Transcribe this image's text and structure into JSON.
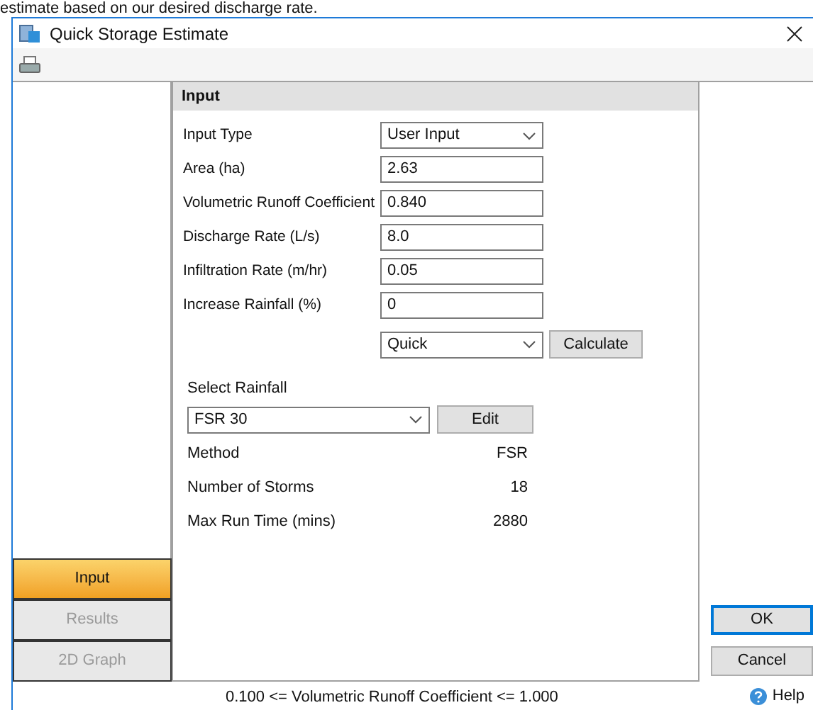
{
  "caption": "estimate based on our desired discharge rate.",
  "window": {
    "title": "Quick Storage Estimate"
  },
  "panel": {
    "title": "Input"
  },
  "fields": [
    {
      "kind": "dropdown",
      "label": "Input Type",
      "value": "User Input"
    },
    {
      "kind": "text",
      "label": "Area (ha)",
      "value": "2.63"
    },
    {
      "kind": "text",
      "label": "Volumetric Runoff Coefficient",
      "value": "0.840"
    },
    {
      "kind": "text",
      "label": "Discharge Rate (L/s)",
      "value": "8.0"
    },
    {
      "kind": "text",
      "label": "Infiltration Rate (m/hr)",
      "value": "0.05"
    },
    {
      "kind": "text",
      "label": "Increase Rainfall (%)",
      "value": "0"
    }
  ],
  "mode": {
    "value": "Quick",
    "button": "Calculate"
  },
  "rainfall": {
    "label": "Select Rainfall",
    "value": "FSR 30",
    "button": "Edit",
    "info": [
      {
        "label": "Method",
        "value": "FSR"
      },
      {
        "label": "Number of Storms",
        "value": "18"
      },
      {
        "label": "Max Run Time (mins)",
        "value": "2880"
      }
    ]
  },
  "nav": [
    {
      "label": "Input",
      "selected": true,
      "disabled": false
    },
    {
      "label": "Results",
      "selected": false,
      "disabled": true
    },
    {
      "label": "2D Graph",
      "selected": false,
      "disabled": true
    }
  ],
  "buttons": [
    {
      "label": "OK",
      "default": true
    },
    {
      "label": "Cancel",
      "default": false
    }
  ],
  "status_bar": {
    "message": "0.100 <= Volumetric Runoff Coefficient <= 1.000",
    "help": "Help"
  }
}
